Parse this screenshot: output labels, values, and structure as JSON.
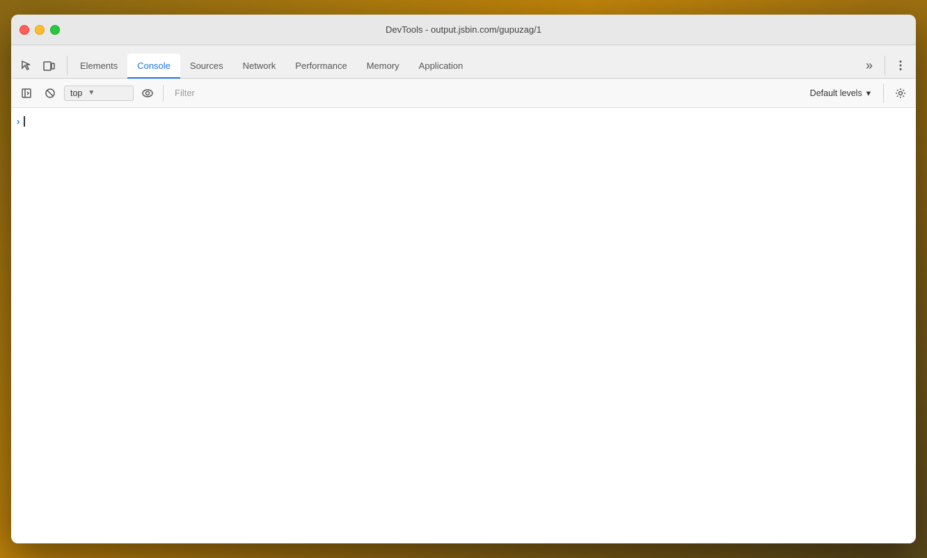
{
  "window": {
    "title": "DevTools - output.jsbin.com/gupuzag/1"
  },
  "traffic_lights": {
    "close_label": "close",
    "minimize_label": "minimize",
    "maximize_label": "maximize"
  },
  "toolbar": {
    "inspect_icon": "⬚",
    "device_icon": "⬜"
  },
  "tabs": [
    {
      "id": "elements",
      "label": "Elements",
      "active": false
    },
    {
      "id": "console",
      "label": "Console",
      "active": true
    },
    {
      "id": "sources",
      "label": "Sources",
      "active": false
    },
    {
      "id": "network",
      "label": "Network",
      "active": false
    },
    {
      "id": "performance",
      "label": "Performance",
      "active": false
    },
    {
      "id": "memory",
      "label": "Memory",
      "active": false
    },
    {
      "id": "application",
      "label": "Application",
      "active": false
    }
  ],
  "console_toolbar": {
    "clear_label": "⊘",
    "sidebar_label": "▶|",
    "context_value": "top",
    "filter_placeholder": "Filter",
    "levels_label": "Default levels",
    "levels_arrow": "▾"
  }
}
